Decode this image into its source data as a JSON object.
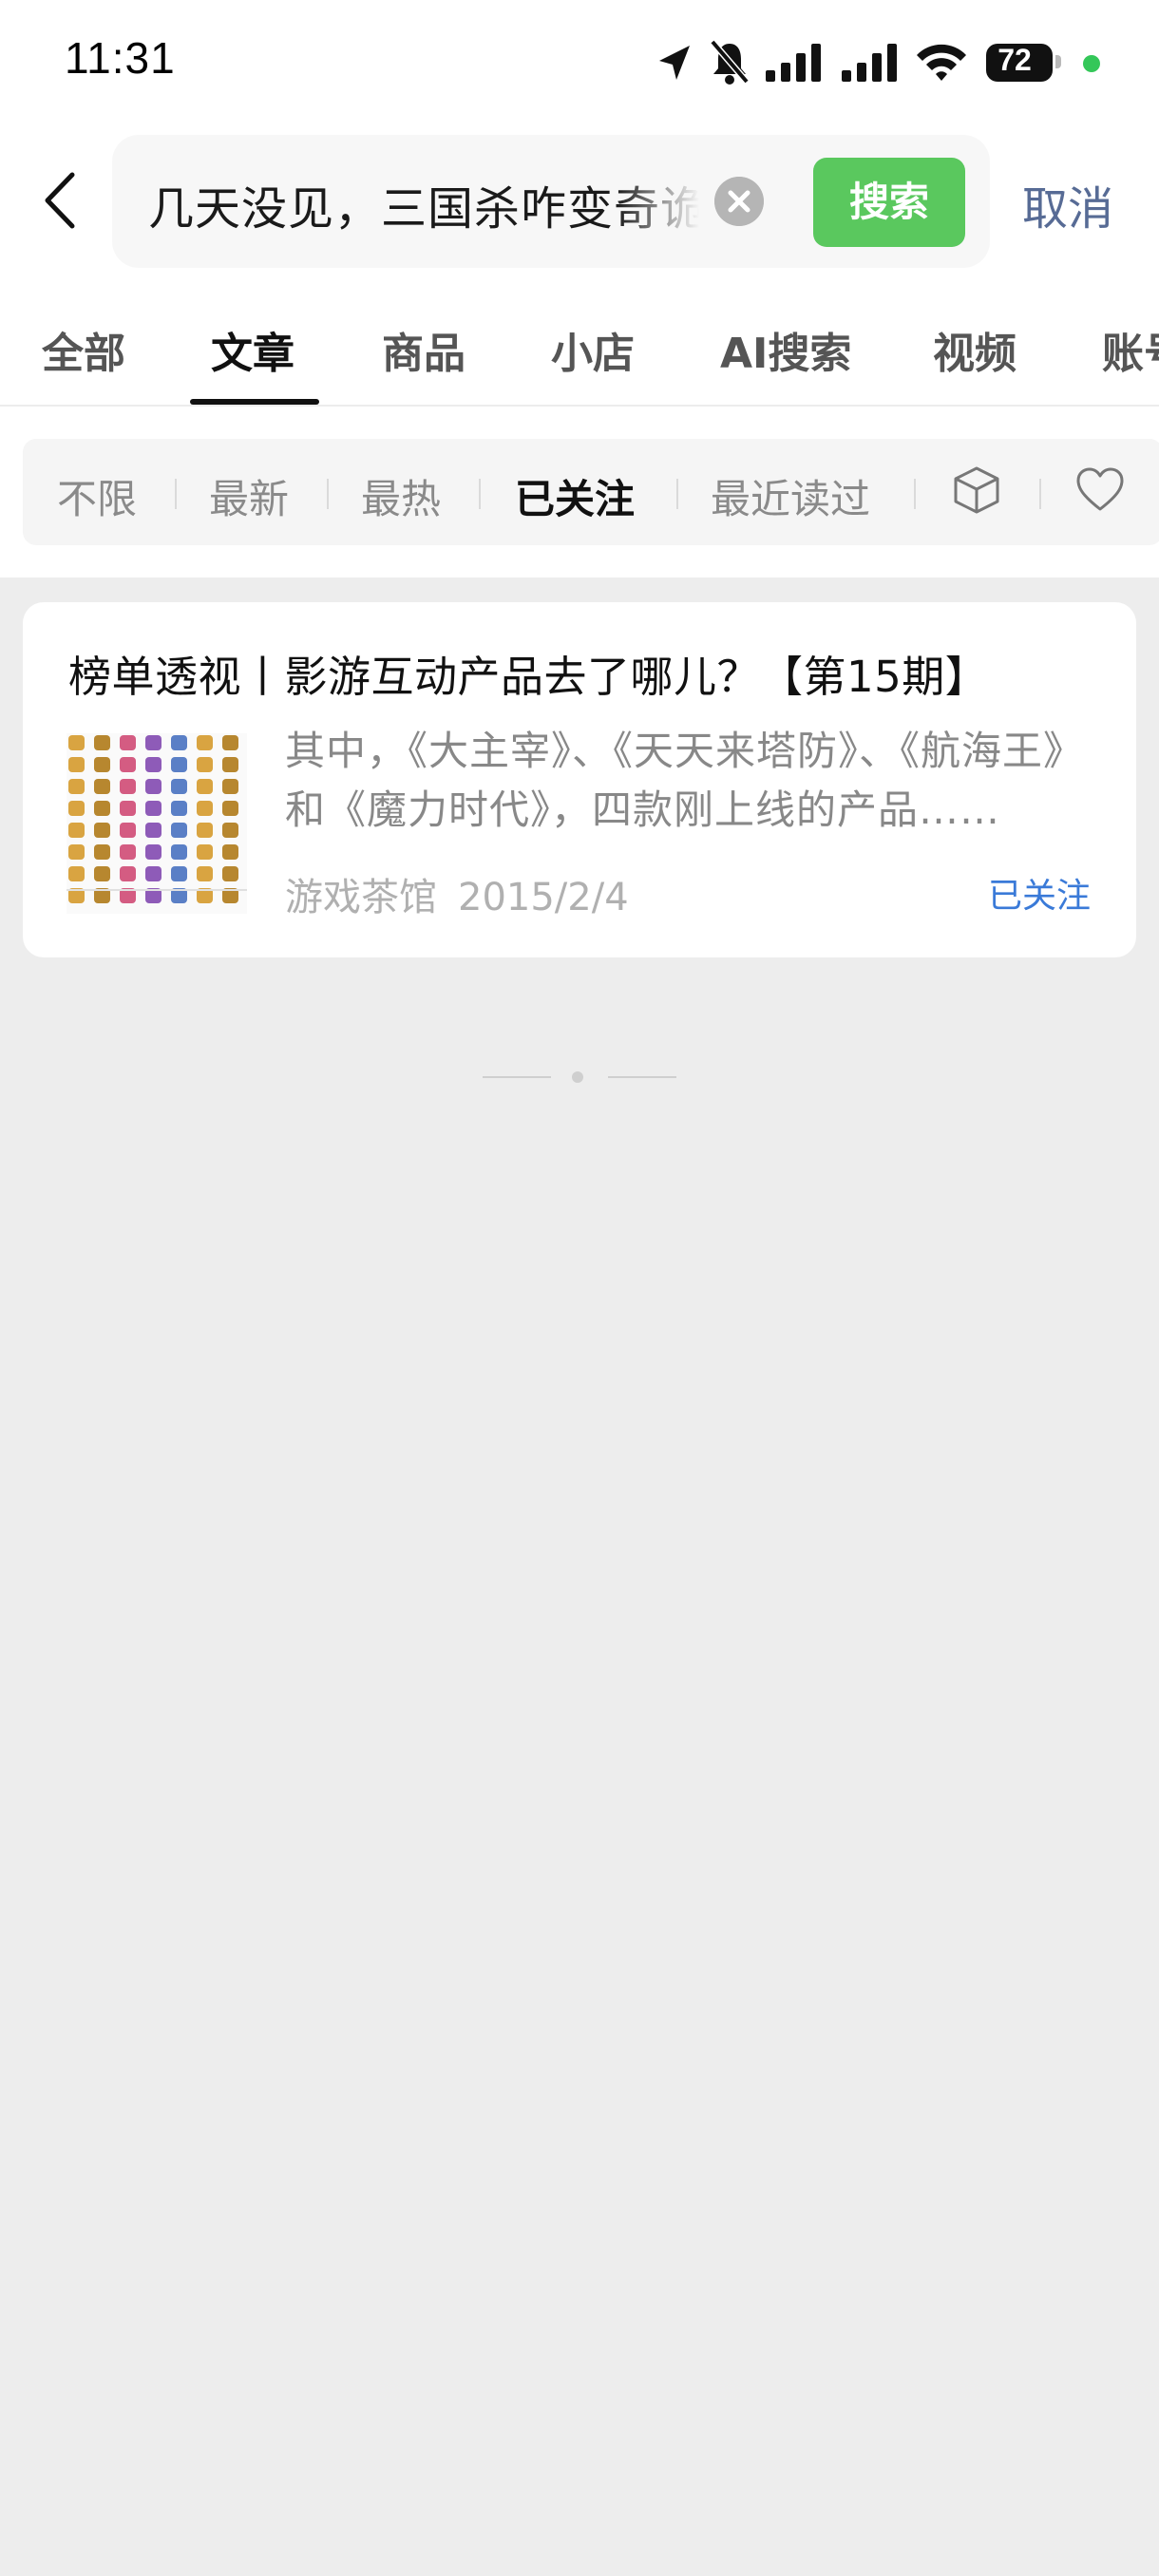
{
  "status_bar": {
    "time": "11:31",
    "battery": "72"
  },
  "search": {
    "query": "几天没见，三国杀咋变奇诡了",
    "button_label": "搜索",
    "cancel_label": "取消"
  },
  "tabs": [
    {
      "label": "全部"
    },
    {
      "label": "文章",
      "active": true
    },
    {
      "label": "商品"
    },
    {
      "label": "小店"
    },
    {
      "label": "AI搜索"
    },
    {
      "label": "视频"
    },
    {
      "label": "账号"
    }
  ],
  "filters": [
    {
      "label": "不限"
    },
    {
      "label": "最新"
    },
    {
      "label": "最热"
    },
    {
      "label": "已关注",
      "active": true
    },
    {
      "label": "最近读过"
    }
  ],
  "filter_icons": [
    "cube-icon",
    "heart-icon"
  ],
  "article": {
    "title": "榜单透视丨影游互动产品去了哪儿？【第15期】",
    "summary": "其中，《大主宰》、《天天来塔防》、《航海王》和《魔力时代》，四款刚上线的产品……",
    "source": "游戏茶馆",
    "date": "2015/2/4",
    "follow_badge": "已关注"
  },
  "colors": {
    "accent_green": "#5ac85e",
    "link_blue": "#576b95",
    "follow_blue": "#3a7ad8"
  }
}
